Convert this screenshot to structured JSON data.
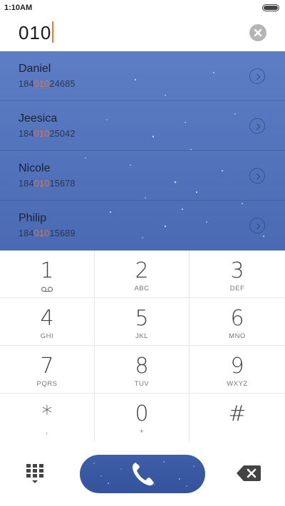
{
  "status": {
    "time": "1:10AM"
  },
  "dialer": {
    "input": "010"
  },
  "contacts": [
    {
      "name": "Daniel",
      "prefix": "184",
      "match": "010",
      "suffix": "24685"
    },
    {
      "name": "Jeesica",
      "prefix": "184",
      "match": "010",
      "suffix": "25042"
    },
    {
      "name": "Nicole",
      "prefix": "184",
      "match": "010",
      "suffix": "15678"
    },
    {
      "name": "Philip",
      "prefix": "184",
      "match": "010",
      "suffix": "15689"
    }
  ],
  "keys": [
    {
      "digit": "1",
      "letters": ""
    },
    {
      "digit": "2",
      "letters": "ABC"
    },
    {
      "digit": "3",
      "letters": "DEF"
    },
    {
      "digit": "4",
      "letters": "GHI"
    },
    {
      "digit": "5",
      "letters": "JKL"
    },
    {
      "digit": "6",
      "letters": "MNO"
    },
    {
      "digit": "7",
      "letters": "PQRS"
    },
    {
      "digit": "8",
      "letters": "TUV"
    },
    {
      "digit": "9",
      "letters": "WXYZ"
    },
    {
      "digit": "*",
      "letters": ","
    },
    {
      "digit": "0",
      "letters": "+"
    },
    {
      "digit": "#",
      "letters": ""
    }
  ],
  "icons": {
    "voicemail": "voicemail-icon",
    "clear": "clear-icon",
    "info": "chevron-right-icon",
    "dialpad": "dialpad-icon",
    "call": "phone-icon",
    "backspace": "backspace-icon"
  },
  "colors": {
    "accent": "#e8703a",
    "caret": "#ff7a1f",
    "results_bg": "#5474bd",
    "call_bg": "#3d5ea8"
  }
}
